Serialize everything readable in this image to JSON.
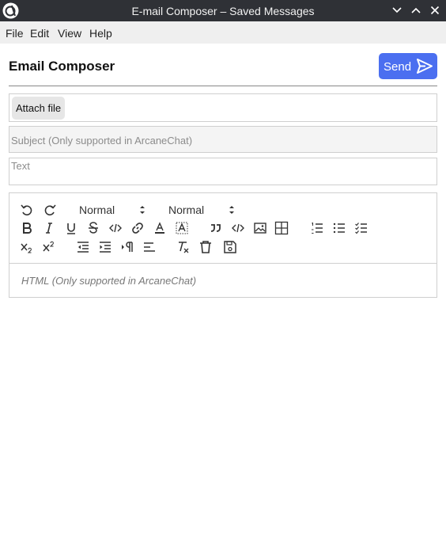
{
  "window": {
    "title": "E-mail Composer – Saved Messages",
    "controls": [
      "minimize",
      "maximize",
      "close"
    ]
  },
  "menu": {
    "items": [
      "File",
      "Edit",
      "View",
      "Help"
    ]
  },
  "header": {
    "title": "Email Composer",
    "send_label": "Send"
  },
  "form": {
    "attach_label": "Attach file",
    "subject_placeholder": "Subject (Only supported in ArcaneChat)",
    "text_placeholder": "Text"
  },
  "editor": {
    "header_select": "Normal",
    "size_select": "Normal",
    "html_placeholder": "HTML (Only supported in ArcaneChat)",
    "toolbar_icons": [
      "undo-icon",
      "redo-icon",
      "bold-icon",
      "italic-icon",
      "underline-icon",
      "strikethrough-icon",
      "code-inline-icon",
      "link-icon",
      "text-color-icon",
      "highlight-icon",
      "blockquote-icon",
      "code-block-icon",
      "image-icon",
      "table-icon",
      "ordered-list-icon",
      "bullet-list-icon",
      "checklist-icon",
      "subscript-icon",
      "superscript-icon",
      "outdent-icon",
      "indent-icon",
      "rtl-icon",
      "align-icon",
      "clear-format-icon",
      "delete-icon",
      "save-icon"
    ]
  },
  "colors": {
    "titlebar": "#2f3136",
    "menubar": "#efefef",
    "accent": "#4b6ff0"
  }
}
